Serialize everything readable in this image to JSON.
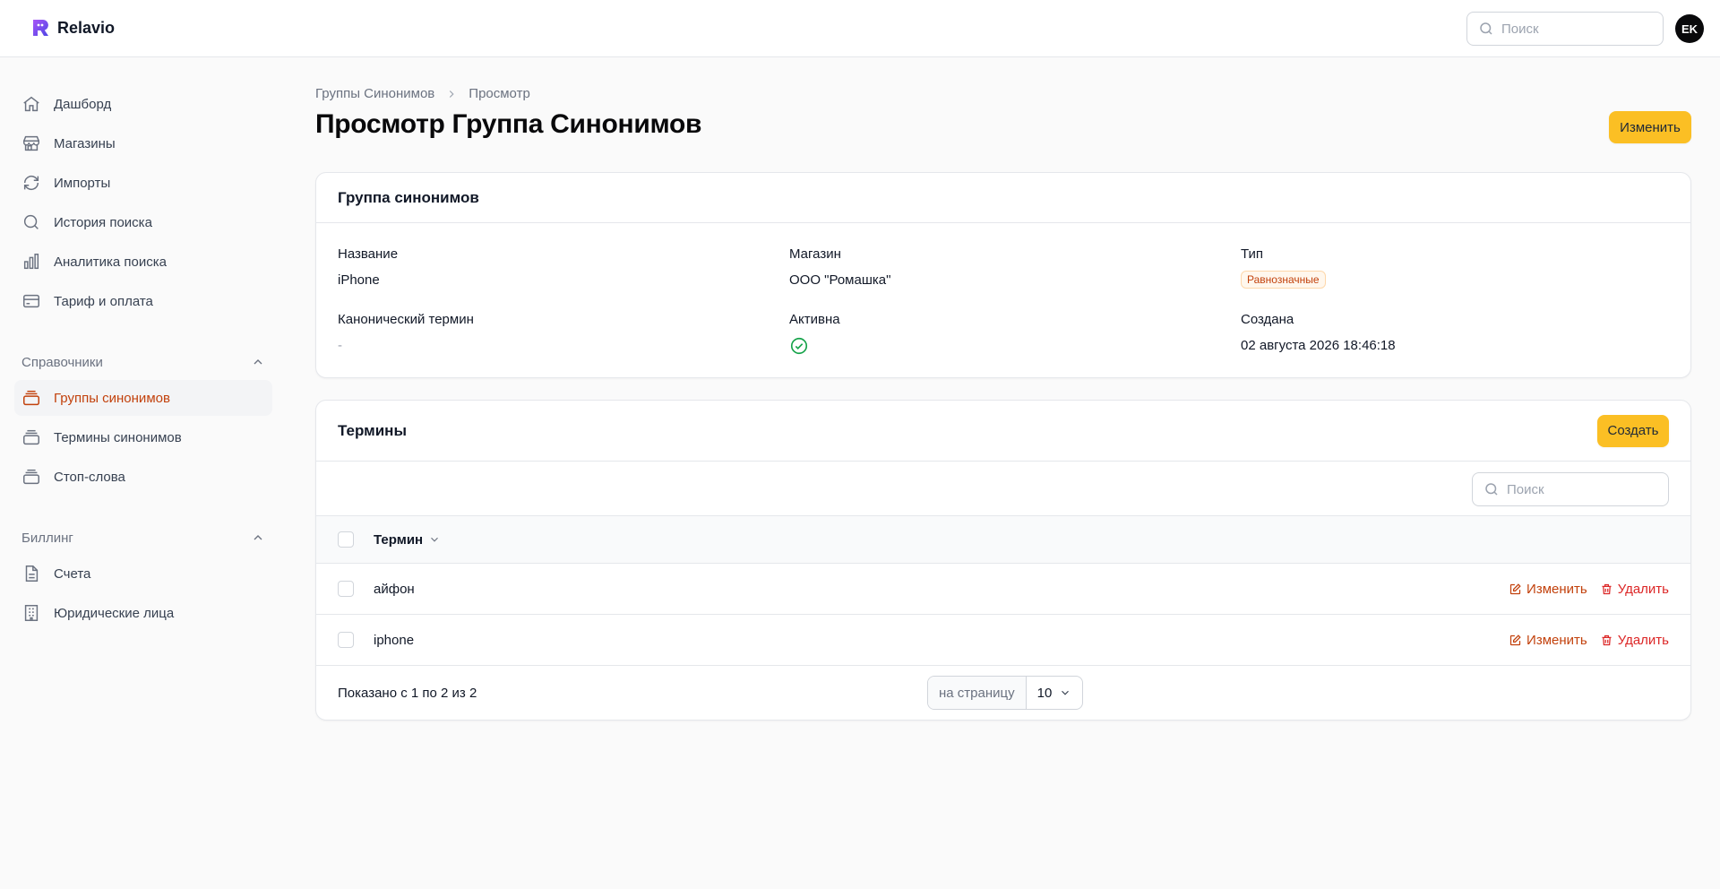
{
  "app": {
    "name": "Relavio"
  },
  "header": {
    "search_placeholder": "Поиск",
    "avatar_initials": "EK"
  },
  "sidebar": {
    "items": [
      {
        "label": "Дашборд",
        "icon": "home-icon"
      },
      {
        "label": "Магазины",
        "icon": "store-icon"
      },
      {
        "label": "Импорты",
        "icon": "refresh-icon"
      },
      {
        "label": "История поиска",
        "icon": "search-icon"
      },
      {
        "label": "Аналитика поиска",
        "icon": "chart-bar-icon"
      },
      {
        "label": "Тариф и оплата",
        "icon": "credit-card-icon"
      }
    ],
    "groups": [
      {
        "label": "Справочники",
        "items": [
          {
            "label": "Группы синонимов",
            "icon": "stack-icon",
            "active": true
          },
          {
            "label": "Термины синонимов",
            "icon": "stack-icon"
          },
          {
            "label": "Стоп-слова",
            "icon": "stack-icon"
          }
        ]
      },
      {
        "label": "Биллинг",
        "items": [
          {
            "label": "Счета",
            "icon": "document-icon"
          },
          {
            "label": "Юридические лица",
            "icon": "building-icon"
          }
        ]
      }
    ]
  },
  "breadcrumb": {
    "parent": "Группы Синонимов",
    "current": "Просмотр"
  },
  "page": {
    "title": "Просмотр Группа Синонимов",
    "edit_label": "Изменить"
  },
  "details": {
    "title": "Группа синонимов",
    "name_label": "Название",
    "name_value": "iPhone",
    "store_label": "Магазин",
    "store_value": "ООО \"Ромашка\"",
    "type_label": "Тип",
    "type_value": "Равнозначные",
    "canonical_label": "Канонический термин",
    "canonical_value": "-",
    "active_label": "Активна",
    "created_label": "Создана",
    "created_value": "02 августа 2026 18:46:18"
  },
  "terms": {
    "title": "Термины",
    "create_label": "Создать",
    "search_placeholder": "Поиск",
    "column_term": "Термин",
    "rows": [
      {
        "term": "айфон",
        "edit": "Изменить",
        "delete": "Удалить"
      },
      {
        "term": "iphone",
        "edit": "Изменить",
        "delete": "Удалить"
      }
    ],
    "shown_text": "Показано с 1 по 2 из 2",
    "per_page_label": "на страницу",
    "per_page_value": "10"
  },
  "colors": {
    "accent": "#fbbf24",
    "active_nav": "#c2410c",
    "danger": "#dc2626",
    "success": "#16a34a"
  }
}
